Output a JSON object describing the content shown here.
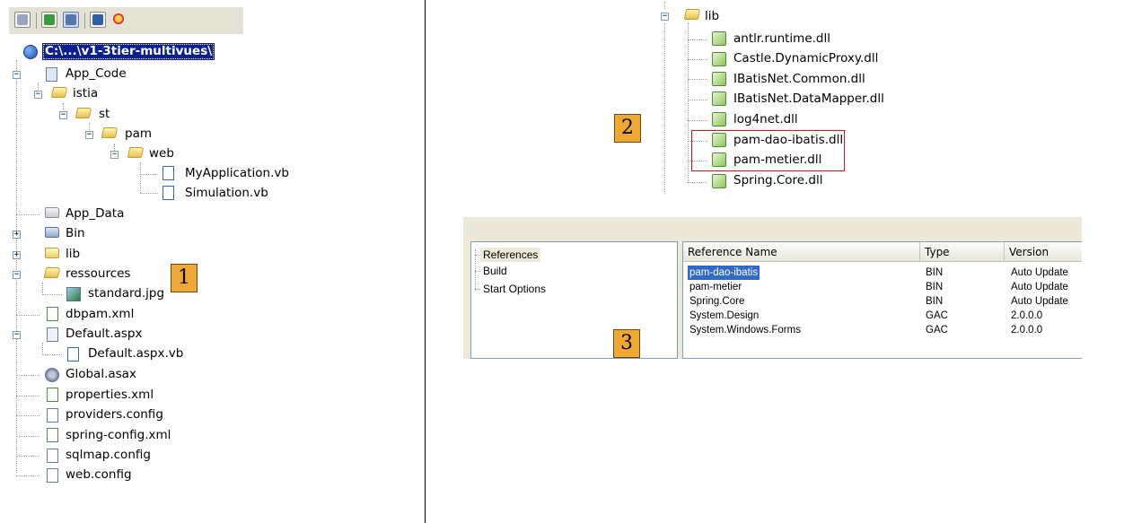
{
  "left_tree": {
    "root_label": "C:\\...\\v1-3tier-multivues\\",
    "items": [
      {
        "label": "App_Code"
      },
      {
        "label": "istia"
      },
      {
        "label": "st"
      },
      {
        "label": "pam"
      },
      {
        "label": "web"
      },
      {
        "label": "MyApplication.vb"
      },
      {
        "label": "Simulation.vb"
      },
      {
        "label": "App_Data"
      },
      {
        "label": "Bin"
      },
      {
        "label": "lib"
      },
      {
        "label": "ressources"
      },
      {
        "label": "standard.jpg"
      },
      {
        "label": "dbpam.xml"
      },
      {
        "label": "Default.aspx"
      },
      {
        "label": "Default.aspx.vb"
      },
      {
        "label": "Global.asax"
      },
      {
        "label": "properties.xml"
      },
      {
        "label": "providers.config"
      },
      {
        "label": "spring-config.xml"
      },
      {
        "label": "sqlmap.config"
      },
      {
        "label": "web.config"
      }
    ]
  },
  "right_tree": {
    "items": [
      {
        "label": "lib"
      },
      {
        "label": "antlr.runtime.dll"
      },
      {
        "label": "Castle.DynamicProxy.dll"
      },
      {
        "label": "IBatisNet.Common.dll"
      },
      {
        "label": "IBatisNet.DataMapper.dll"
      },
      {
        "label": "log4net.dll"
      },
      {
        "label": "pam-dao-ibatis.dll"
      },
      {
        "label": "pam-metier.dll"
      },
      {
        "label": "Spring.Core.dll"
      }
    ]
  },
  "markers": {
    "one": "1",
    "two": "2",
    "three": "3"
  },
  "references": {
    "nav": [
      {
        "label": "References"
      },
      {
        "label": "Build"
      },
      {
        "label": "Start Options"
      }
    ],
    "columns": [
      {
        "label": "Reference Name"
      },
      {
        "label": "Type"
      },
      {
        "label": "Version"
      }
    ],
    "rows": [
      {
        "name": "pam-dao-ibatis",
        "type": "BIN",
        "version": "Auto Update"
      },
      {
        "name": "pam-metier",
        "type": "BIN",
        "version": "Auto Update"
      },
      {
        "name": "Spring.Core",
        "type": "BIN",
        "version": "Auto Update"
      },
      {
        "name": "System.Design",
        "type": "GAC",
        "version": "2.0.0.0"
      },
      {
        "name": "System.Windows.Forms",
        "type": "GAC",
        "version": "2.0.0.0"
      }
    ]
  },
  "colors": {
    "selection": "#0b1f8e",
    "highlight_box": "#e01010",
    "marker": "#f0a834",
    "row_select": "#316ac5"
  }
}
